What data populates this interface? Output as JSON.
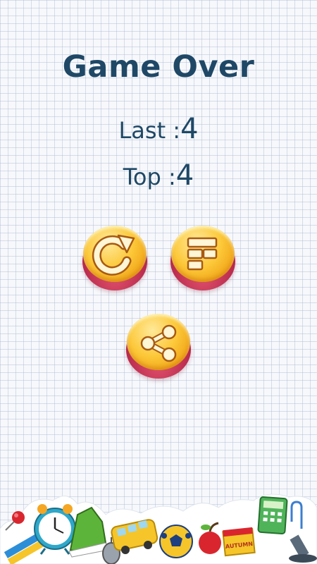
{
  "title": "Game Over",
  "last": {
    "label": "Last :",
    "value": "4"
  },
  "top": {
    "label": "Top :",
    "value": "4"
  },
  "buttons": {
    "replay_icon": "replay-arrow-icon",
    "leaderboard_icon": "leaderboard-icon",
    "share_icon": "share-icon"
  },
  "decor": {
    "calendar_text": "AUTUMN"
  },
  "colors": {
    "title": "#1f4866",
    "button_face": "#fcc93a",
    "button_base": "#b8294b",
    "icon_fill": "#fff6d6",
    "icon_stroke": "#a85a12"
  }
}
